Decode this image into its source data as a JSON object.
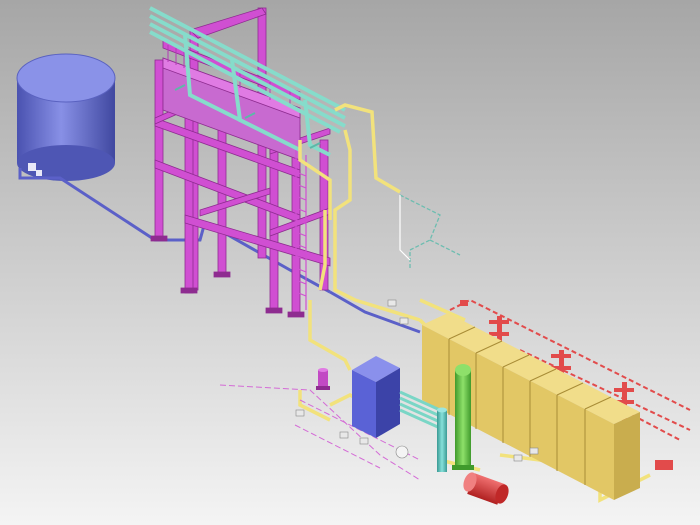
{
  "scene": {
    "background_top": "#a9a9a9",
    "background_bottom": "#f2f2f2",
    "colors": {
      "tank": "#6f78d8",
      "tank_dark": "#4850a8",
      "structure": "#d24fd4",
      "structure_dark": "#9a2f9c",
      "pipe_teal": "#7fd8c8",
      "pipe_yellow": "#f0e27a",
      "pipe_blue": "#6b6fd0",
      "pipe_red": "#e04a4a",
      "module": "#e8cf6a",
      "module_dark": "#b69a3c",
      "vessel_blue": "#5a63d6",
      "column_green": "#6fcf4a",
      "column_teal": "#5fc8c0",
      "drum_red": "#e23a3a"
    },
    "components": [
      "storage-tank-icon",
      "pipe-rack-structure-icon",
      "ladder-icon",
      "module-row-icon",
      "blue-vessel-icon",
      "green-column-icon",
      "teal-column-icon",
      "red-drum-icon",
      "pump-icon"
    ]
  }
}
